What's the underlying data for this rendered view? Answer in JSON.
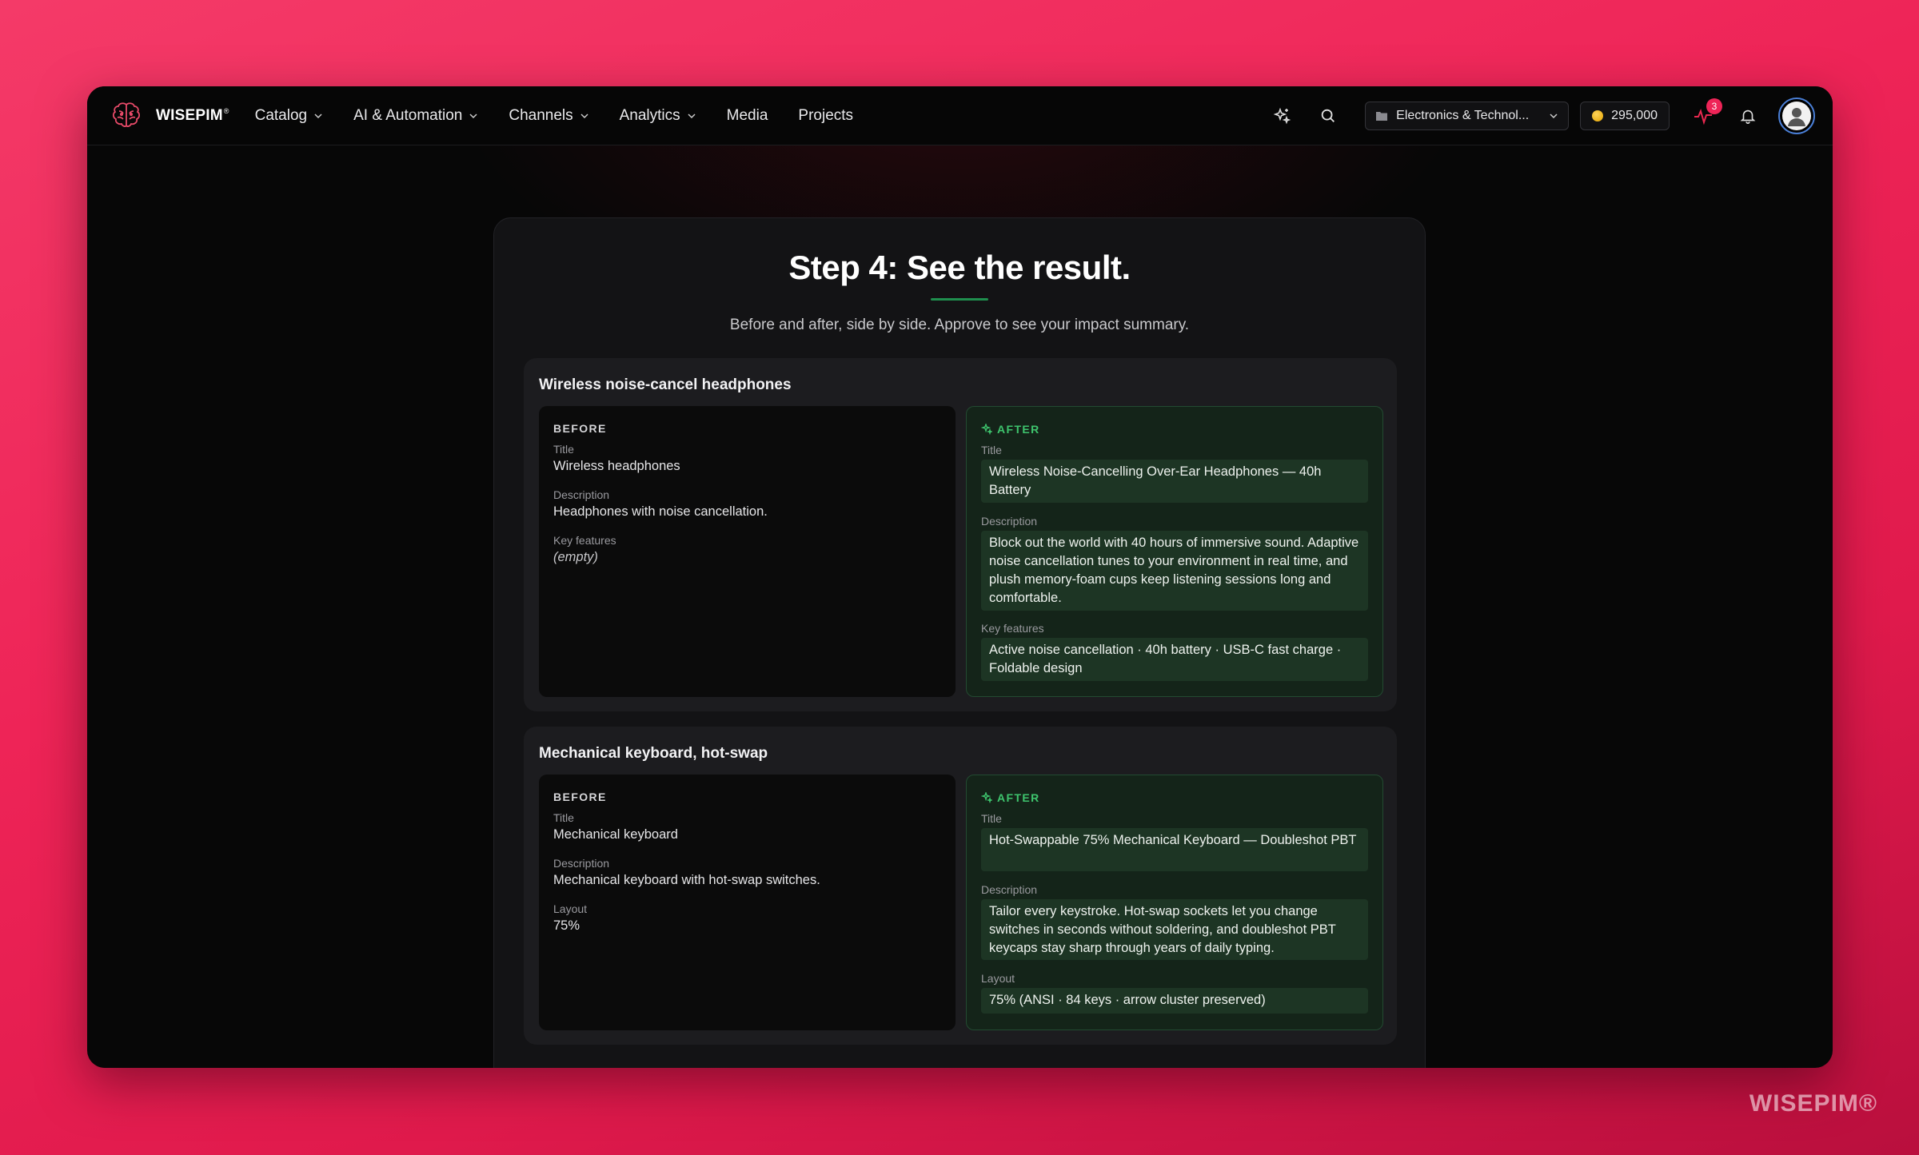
{
  "brand": {
    "name": "WISEPIM",
    "mark": "®"
  },
  "nav": {
    "menu": [
      {
        "label": "Catalog",
        "dropdown": true
      },
      {
        "label": "AI & Automation",
        "dropdown": true
      },
      {
        "label": "Channels",
        "dropdown": true
      },
      {
        "label": "Analytics",
        "dropdown": true
      },
      {
        "label": "Media",
        "dropdown": false
      },
      {
        "label": "Projects",
        "dropdown": false
      }
    ],
    "org_select": "Electronics & Technol...",
    "credits": "295,000",
    "notification_count": "3"
  },
  "page": {
    "title": "Step 4: See the result.",
    "subtitle": "Before and after, side by side. Approve to see your impact summary."
  },
  "labels": {
    "before": "BEFORE",
    "after": "AFTER"
  },
  "products": [
    {
      "name": "Wireless noise-cancel headphones",
      "before": {
        "title_label": "Title",
        "title": "Wireless headphones",
        "desc_label": "Description",
        "desc": "Headphones with noise cancellation.",
        "extra_label": "Key features",
        "extra": "(empty)"
      },
      "after": {
        "title_label": "Title",
        "title": "Wireless Noise-Cancelling Over-Ear Headphones — 40h Battery",
        "desc_label": "Description",
        "desc": "Block out the world with 40 hours of immersive sound. Adaptive noise cancellation tunes to your environment in real time, and plush memory-foam cups keep listening sessions long and comfortable.",
        "extra_label": "Key features",
        "extra": "Active noise cancellation · 40h battery · USB-C fast charge · Foldable design"
      }
    },
    {
      "name": "Mechanical keyboard, hot-swap",
      "before": {
        "title_label": "Title",
        "title": "Mechanical keyboard",
        "desc_label": "Description",
        "desc": "Mechanical keyboard with hot-swap switches.",
        "extra_label": "Layout",
        "extra": "75%"
      },
      "after": {
        "title_label": "Title",
        "title": "Hot-Swappable 75% Mechanical Keyboard — Doubleshot PBT",
        "desc_label": "Description",
        "desc": "Tailor every keystroke. Hot-swap sockets let you change switches in seconds without soldering, and doubleshot PBT keycaps stay sharp through years of daily typing.",
        "extra_label": "Layout",
        "extra": "75% (ANSI · 84 keys · arrow cluster preserved)"
      }
    }
  ],
  "watermark": "WISEPIM®",
  "colors": {
    "accent": "#ee2457",
    "success": "#3ec46d",
    "background": "#070707"
  }
}
